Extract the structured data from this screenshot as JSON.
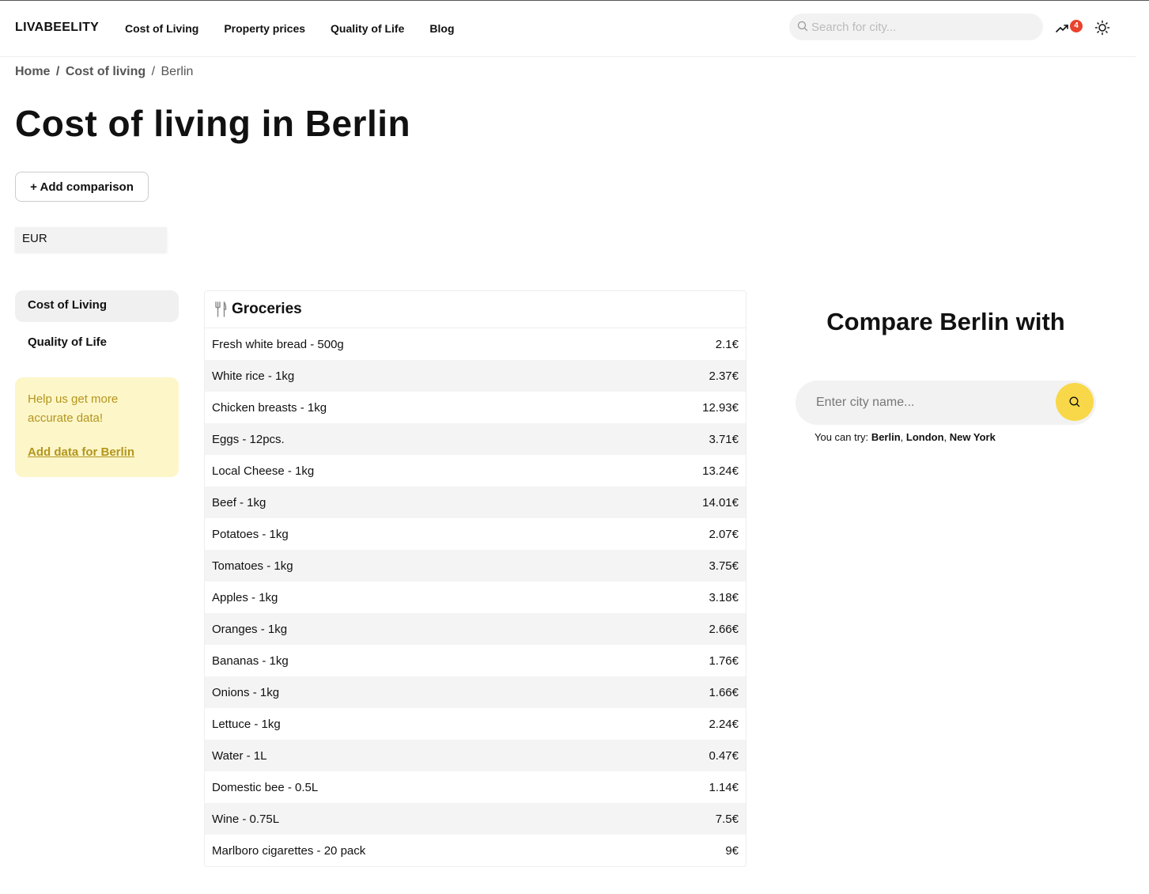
{
  "header": {
    "logo": "LIVABEELITY",
    "nav": [
      "Cost of Living",
      "Property prices",
      "Quality of Life",
      "Blog"
    ],
    "search_placeholder": "Search for city...",
    "trend_badge": "4"
  },
  "breadcrumb": {
    "home": "Home",
    "sep1": "/",
    "cost_of_living": "Cost of living",
    "sep2": "/",
    "current": "Berlin"
  },
  "page_title": "Cost of living in Berlin",
  "add_comparison": "+ Add comparison",
  "currency": "EUR",
  "sidebar": {
    "items": [
      "Cost of Living",
      "Quality of Life"
    ],
    "help_text": "Help us get more accurate data!",
    "help_link": "Add data for Berlin"
  },
  "groceries": {
    "title": "Groceries",
    "rows": [
      {
        "item": "Fresh white bread - 500g",
        "price": "2.1€"
      },
      {
        "item": "White rice - 1kg",
        "price": "2.37€"
      },
      {
        "item": "Chicken breasts - 1kg",
        "price": "12.93€"
      },
      {
        "item": "Eggs - 12pcs.",
        "price": "3.71€"
      },
      {
        "item": "Local Cheese - 1kg",
        "price": "13.24€"
      },
      {
        "item": "Beef - 1kg",
        "price": "14.01€"
      },
      {
        "item": "Potatoes - 1kg",
        "price": "2.07€"
      },
      {
        "item": "Tomatoes - 1kg",
        "price": "3.75€"
      },
      {
        "item": "Apples - 1kg",
        "price": "3.18€"
      },
      {
        "item": "Oranges - 1kg",
        "price": "2.66€"
      },
      {
        "item": "Bananas - 1kg",
        "price": "1.76€"
      },
      {
        "item": "Onions - 1kg",
        "price": "1.66€"
      },
      {
        "item": "Lettuce - 1kg",
        "price": "2.24€"
      },
      {
        "item": "Water - 1L",
        "price": "0.47€"
      },
      {
        "item": "Domestic bee - 0.5L",
        "price": "1.14€"
      },
      {
        "item": "Wine - 0.75L",
        "price": "7.5€"
      },
      {
        "item": "Marlboro cigarettes - 20 pack",
        "price": "9€"
      }
    ]
  },
  "compare": {
    "title": "Compare Berlin with",
    "placeholder": "Enter city name...",
    "try_label": "You can try:",
    "suggestions": [
      "Berlin",
      "London",
      "New York"
    ]
  },
  "colors": {
    "accent_yellow": "#f8d849",
    "help_bg": "#fdf6c8",
    "help_text": "#b3951e",
    "badge_red": "#e8432e"
  },
  "icons": [
    "search-icon",
    "trending-icon",
    "sun-icon",
    "fork-knife-icon"
  ]
}
